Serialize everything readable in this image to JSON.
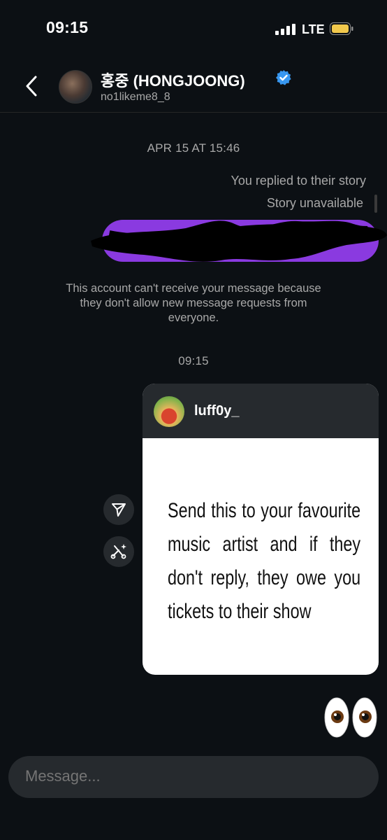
{
  "status_bar": {
    "time": "09:15",
    "network": "LTE",
    "icons": [
      "signal-icon",
      "battery-icon"
    ]
  },
  "header": {
    "display_name": "홍중 (HONGJOONG)",
    "username": "no1likeme8_8",
    "icons": [
      "back-chevron-icon",
      "verified-badge-icon"
    ]
  },
  "messages": {
    "timestamp_1": "APR 15 AT 15:46",
    "reply_note": "You replied to their story",
    "story_unavailable": "Story unavailable",
    "restriction_notice": "This account can't receive your message because they don't allow new message requests from everyone.",
    "timestamp_2": "09:15",
    "shared_post": {
      "username": "luff0y_",
      "text": "Send this to your favourite music artist and if they don't reply, they owe you tickets to their show"
    },
    "emoji_message": "👀",
    "action_icons": [
      "share-icon",
      "ai-sparkle-icon"
    ]
  },
  "composer": {
    "placeholder": "Message..."
  },
  "colors": {
    "background": "#0c1014",
    "bubble_purple": "#8a3ae0",
    "surface": "#262a2e",
    "verified": "#3897f0",
    "battery": "#f2c94c"
  }
}
